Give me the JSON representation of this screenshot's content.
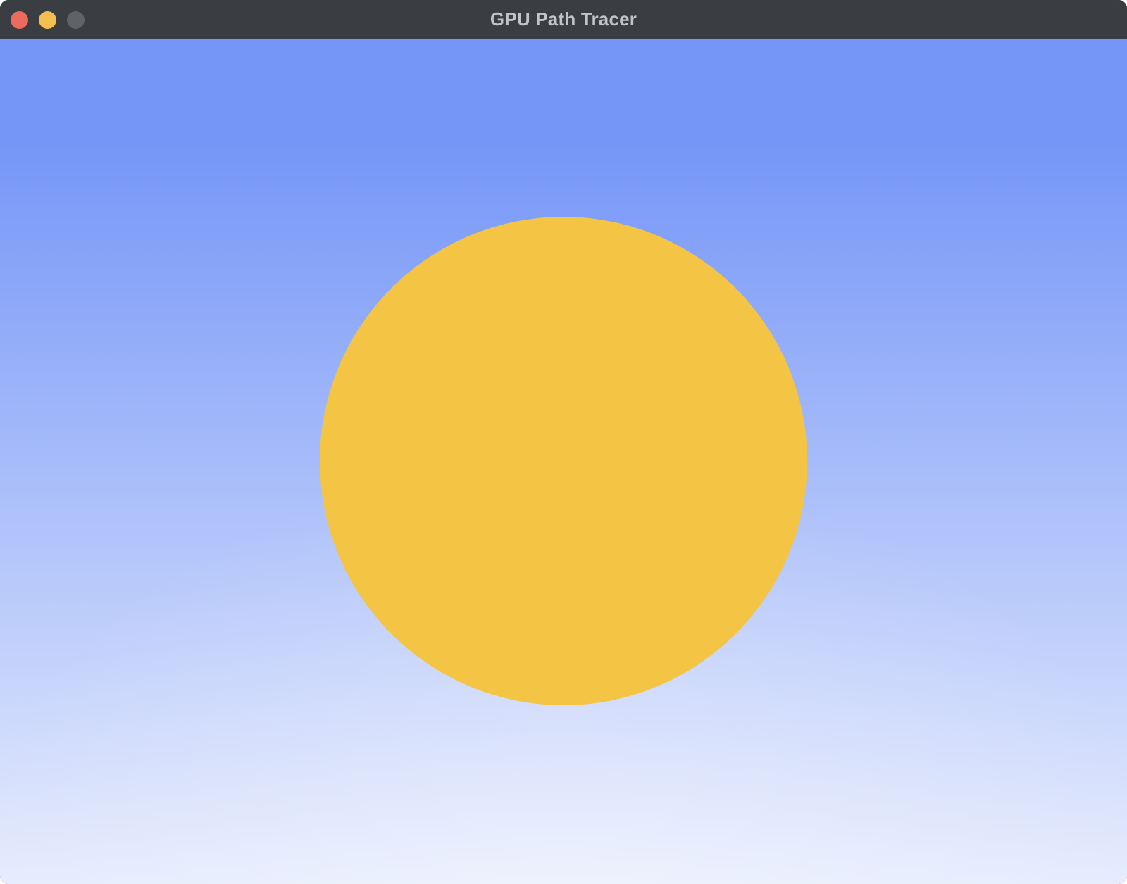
{
  "window": {
    "title": "GPU Path Tracer",
    "controls": [
      {
        "name": "close",
        "color": "#ed6a5e"
      },
      {
        "name": "minimize",
        "color": "#f4bf4f"
      },
      {
        "name": "zoom",
        "color": "#5f6266"
      }
    ]
  },
  "scene": {
    "sky_top_color": "#7596f7",
    "sky_bottom_color": "#e6ecfd",
    "sphere_color": "#f4c444"
  }
}
